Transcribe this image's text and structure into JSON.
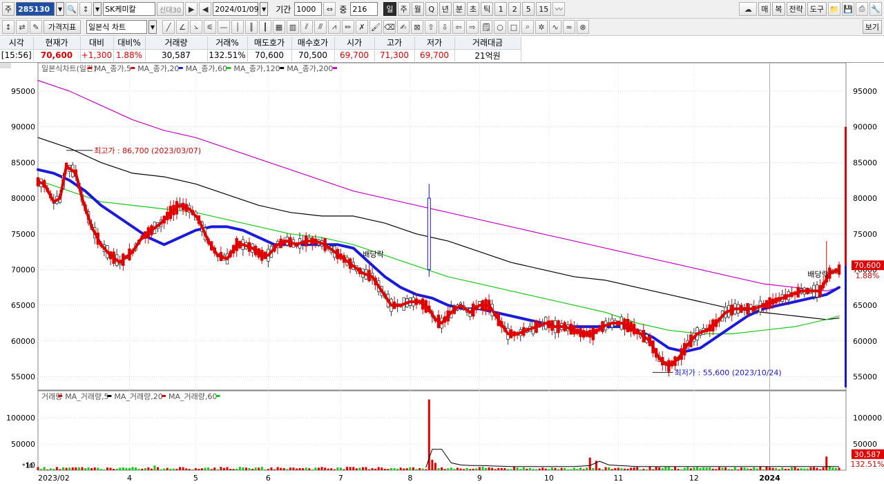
{
  "toolbar1": {
    "market_label": "주",
    "code": "285130",
    "name": "SK케미칼",
    "credit_label": "신대30",
    "date": "2024/01/09",
    "period_label": "기간",
    "period_value": "1000",
    "mid_label": "중",
    "mid_value": "216",
    "period_buttons": [
      "일",
      "주",
      "월",
      "Q",
      "년",
      "분",
      "초",
      "틱",
      "1",
      "2",
      "5",
      "15"
    ],
    "right_buttons": [
      "매",
      "복",
      "전략",
      "도구"
    ]
  },
  "toolbar2": {
    "indicator_label": "가격지표",
    "chart_type": "일본식 차트",
    "view_label": "보기"
  },
  "quote": {
    "headers": [
      "시각",
      "현재가",
      "대비",
      "대비%",
      "거래량",
      "거래%",
      "매도호가",
      "매수호가",
      "시가",
      "고가",
      "저가",
      "거래대금"
    ],
    "values": [
      "[15:56]",
      "70,600",
      "+1,300",
      "1.88%",
      "30,587",
      "132.51%",
      "70,600",
      "70,500",
      "69,700",
      "71,300",
      "69,700",
      "21억원"
    ]
  },
  "legend": {
    "price": [
      "일본식차트(일간)",
      "MA_종가,5",
      "MA_종가,20",
      "MA_종가,60",
      "MA_종가,120",
      "MA_종가,200"
    ],
    "volume": [
      "거래량",
      "MA_거래량,5",
      "MA_거래량,20",
      "MA_거래량,60"
    ]
  },
  "annotations": {
    "high": "최고가 : 86,700 (2023/03/07)",
    "low": "최저가 : 55,600 (2023/10/24)",
    "dividend1": "배당락",
    "dividend2": "배당락",
    "current_price": "70,600",
    "current_pct": "1.88%",
    "current_vol": "30,587",
    "current_vol_pct": "132.51%",
    "vol_scale": "*10"
  },
  "colors": {
    "ma5": "#e00000",
    "ma20": "#1a1adc",
    "ma60": "#14c814",
    "ma120": "#000000",
    "ma200": "#c800c8",
    "up": "#e00000",
    "down": "#1414d2"
  },
  "chart_data": {
    "type": "candlestick",
    "y_ticks": [
      95000,
      90000,
      85000,
      80000,
      75000,
      70000,
      65000,
      60000,
      55000
    ],
    "y_tick_labels": [
      "95000",
      "90000",
      "85000",
      "80000",
      "75000",
      "70000",
      "65000",
      "60000",
      "55000"
    ],
    "ylim": [
      53500,
      98000
    ],
    "volume_ticks": [
      100000,
      50000,
      10000
    ],
    "volume_tick_labels": [
      "100000",
      "50000",
      "10"
    ],
    "x_labels": [
      "2023/02",
      "4",
      "5",
      "6",
      "7",
      "8",
      "9",
      "10",
      "11",
      "12",
      "2024"
    ],
    "ma5": [
      [
        0,
        82300
      ],
      [
        2,
        82000
      ],
      [
        5,
        79500
      ],
      [
        7,
        80000
      ],
      [
        9,
        84500
      ],
      [
        12,
        83500
      ],
      [
        14,
        80000
      ],
      [
        17,
        76000
      ],
      [
        20,
        73500
      ],
      [
        23,
        72000
      ],
      [
        26,
        71000
      ],
      [
        30,
        72500
      ],
      [
        33,
        74500
      ],
      [
        36,
        75500
      ],
      [
        39,
        76500
      ],
      [
        42,
        78000
      ],
      [
        45,
        79000
      ],
      [
        48,
        78500
      ],
      [
        51,
        77000
      ],
      [
        54,
        74000
      ],
      [
        57,
        72000
      ],
      [
        60,
        71500
      ],
      [
        63,
        73500
      ],
      [
        65,
        73500
      ],
      [
        68,
        73000
      ],
      [
        71,
        72000
      ],
      [
        73,
        72000
      ],
      [
        76,
        73500
      ],
      [
        79,
        74000
      ],
      [
        82,
        73500
      ],
      [
        85,
        74000
      ],
      [
        88,
        74000
      ],
      [
        91,
        73500
      ],
      [
        94,
        72500
      ],
      [
        97,
        71500
      ],
      [
        100,
        70500
      ],
      [
        103,
        69500
      ],
      [
        106,
        69000
      ],
      [
        109,
        67000
      ],
      [
        112,
        65000
      ],
      [
        115,
        65000
      ],
      [
        118,
        65500
      ],
      [
        121,
        65500
      ],
      [
        124,
        64500
      ],
      [
        126,
        63000
      ],
      [
        128,
        62500
      ],
      [
        131,
        64000
      ],
      [
        134,
        65000
      ],
      [
        137,
        64000
      ],
      [
        140,
        65000
      ],
      [
        143,
        65000
      ],
      [
        146,
        63000
      ],
      [
        149,
        61000
      ],
      [
        152,
        61000
      ],
      [
        155,
        61500
      ],
      [
        158,
        62000
      ],
      [
        161,
        62500
      ],
      [
        164,
        62000
      ],
      [
        167,
        62000
      ],
      [
        170,
        61500
      ],
      [
        173,
        61000
      ],
      [
        176,
        61000
      ],
      [
        179,
        62000
      ],
      [
        182,
        62500
      ],
      [
        185,
        62500
      ],
      [
        188,
        62000
      ],
      [
        191,
        61000
      ],
      [
        194,
        60000
      ],
      [
        197,
        57500
      ],
      [
        200,
        56500
      ],
      [
        203,
        57500
      ],
      [
        206,
        59500
      ],
      [
        209,
        61000
      ],
      [
        212,
        61500
      ],
      [
        215,
        62500
      ],
      [
        218,
        64000
      ],
      [
        221,
        64500
      ],
      [
        224,
        64500
      ],
      [
        227,
        64500
      ],
      [
        230,
        65000
      ],
      [
        233,
        65500
      ],
      [
        236,
        66000
      ],
      [
        239,
        66500
      ],
      [
        242,
        67000
      ],
      [
        245,
        67000
      ],
      [
        248,
        67000
      ],
      [
        251,
        69500
      ],
      [
        254,
        70000
      ]
    ],
    "ma20": [
      [
        0,
        84000
      ],
      [
        5,
        83500
      ],
      [
        10,
        82500
      ],
      [
        15,
        81000
      ],
      [
        20,
        79000
      ],
      [
        25,
        77500
      ],
      [
        30,
        76000
      ],
      [
        35,
        74500
      ],
      [
        40,
        73500
      ],
      [
        45,
        74500
      ],
      [
        50,
        75500
      ],
      [
        55,
        76000
      ],
      [
        60,
        76000
      ],
      [
        65,
        75500
      ],
      [
        70,
        74500
      ],
      [
        75,
        73500
      ],
      [
        80,
        73500
      ],
      [
        85,
        73500
      ],
      [
        90,
        73500
      ],
      [
        95,
        73500
      ],
      [
        100,
        73000
      ],
      [
        105,
        71000
      ],
      [
        110,
        69000
      ],
      [
        115,
        67500
      ],
      [
        120,
        66500
      ],
      [
        125,
        66000
      ],
      [
        130,
        65000
      ],
      [
        135,
        64500
      ],
      [
        140,
        64500
      ],
      [
        145,
        64000
      ],
      [
        150,
        63500
      ],
      [
        155,
        63000
      ],
      [
        160,
        62500
      ],
      [
        165,
        62000
      ],
      [
        170,
        62000
      ],
      [
        175,
        62000
      ],
      [
        180,
        62000
      ],
      [
        185,
        62000
      ],
      [
        190,
        61500
      ],
      [
        195,
        60500
      ],
      [
        200,
        59000
      ],
      [
        205,
        58500
      ],
      [
        210,
        59000
      ],
      [
        215,
        60500
      ],
      [
        220,
        62000
      ],
      [
        225,
        63500
      ],
      [
        230,
        64500
      ],
      [
        235,
        65000
      ],
      [
        240,
        65500
      ],
      [
        245,
        66000
      ],
      [
        250,
        66500
      ],
      [
        254,
        67500
      ]
    ],
    "ma60": [
      [
        0,
        82500
      ],
      [
        10,
        81000
      ],
      [
        20,
        79500
      ],
      [
        30,
        79000
      ],
      [
        40,
        78500
      ],
      [
        50,
        78000
      ],
      [
        60,
        77000
      ],
      [
        70,
        76000
      ],
      [
        80,
        75000
      ],
      [
        90,
        74500
      ],
      [
        100,
        73500
      ],
      [
        110,
        72000
      ],
      [
        120,
        70500
      ],
      [
        130,
        69000
      ],
      [
        140,
        68000
      ],
      [
        150,
        67000
      ],
      [
        160,
        66000
      ],
      [
        170,
        65000
      ],
      [
        180,
        64000
      ],
      [
        190,
        62500
      ],
      [
        200,
        61500
      ],
      [
        210,
        61000
      ],
      [
        220,
        61000
      ],
      [
        230,
        61500
      ],
      [
        240,
        62000
      ],
      [
        250,
        63000
      ],
      [
        254,
        63500
      ]
    ],
    "ma120": [
      [
        0,
        88500
      ],
      [
        10,
        87000
      ],
      [
        20,
        85000
      ],
      [
        30,
        83500
      ],
      [
        40,
        83000
      ],
      [
        50,
        82000
      ],
      [
        60,
        80500
      ],
      [
        70,
        79000
      ],
      [
        80,
        78000
      ],
      [
        90,
        77500
      ],
      [
        100,
        77500
      ],
      [
        110,
        76500
      ],
      [
        120,
        75000
      ],
      [
        130,
        74000
      ],
      [
        140,
        72500
      ],
      [
        150,
        71000
      ],
      [
        160,
        70000
      ],
      [
        170,
        69000
      ],
      [
        180,
        68500
      ],
      [
        190,
        67500
      ],
      [
        200,
        66500
      ],
      [
        210,
        65500
      ],
      [
        220,
        64500
      ],
      [
        230,
        64000
      ],
      [
        240,
        63500
      ],
      [
        250,
        63000
      ],
      [
        254,
        63200
      ]
    ],
    "ma200": [
      [
        0,
        96500
      ],
      [
        10,
        95000
      ],
      [
        20,
        93000
      ],
      [
        30,
        91000
      ],
      [
        40,
        89500
      ],
      [
        50,
        88500
      ],
      [
        60,
        87000
      ],
      [
        70,
        85500
      ],
      [
        80,
        84000
      ],
      [
        90,
        82500
      ],
      [
        100,
        81000
      ],
      [
        110,
        80000
      ],
      [
        120,
        79000
      ],
      [
        130,
        78000
      ],
      [
        140,
        77000
      ],
      [
        150,
        76000
      ],
      [
        160,
        75000
      ],
      [
        170,
        74000
      ],
      [
        180,
        73000
      ],
      [
        190,
        72000
      ],
      [
        200,
        71000
      ],
      [
        210,
        70000
      ],
      [
        220,
        69000
      ],
      [
        230,
        68000
      ],
      [
        240,
        67500
      ],
      [
        250,
        67000
      ],
      [
        254,
        67500
      ]
    ],
    "volume": {
      "spikes": [
        [
          0,
          6000
        ],
        [
          10,
          5000
        ],
        [
          17,
          4000
        ],
        [
          30,
          6000
        ],
        [
          34,
          4000
        ],
        [
          37,
          9000
        ],
        [
          45,
          6000
        ],
        [
          54,
          5000
        ],
        [
          60,
          6000
        ],
        [
          69,
          5000
        ],
        [
          84,
          4000
        ],
        [
          96,
          5000
        ],
        [
          104,
          6000
        ],
        [
          115,
          5000
        ],
        [
          124,
          135000
        ],
        [
          125,
          20000
        ],
        [
          126,
          14000
        ],
        [
          140,
          6000
        ],
        [
          152,
          5000
        ],
        [
          160,
          5000
        ],
        [
          172,
          5000
        ],
        [
          175,
          24000
        ],
        [
          177,
          18000
        ],
        [
          180,
          6000
        ],
        [
          200,
          6000
        ],
        [
          212,
          5000
        ],
        [
          224,
          5000
        ],
        [
          236,
          5000
        ],
        [
          250,
          26000
        ],
        [
          251,
          8000
        ],
        [
          254,
          5000
        ]
      ],
      "ma20": [
        [
          123,
          5000
        ],
        [
          125,
          40000
        ],
        [
          128,
          40000
        ],
        [
          131,
          14000
        ],
        [
          134,
          10000
        ],
        [
          137,
          9000
        ],
        [
          140,
          9000
        ],
        [
          150,
          7000
        ],
        [
          170,
          7000
        ],
        [
          175,
          9000
        ],
        [
          178,
          17000
        ],
        [
          181,
          10000
        ],
        [
          190,
          7000
        ],
        [
          254,
          7000
        ]
      ]
    }
  }
}
